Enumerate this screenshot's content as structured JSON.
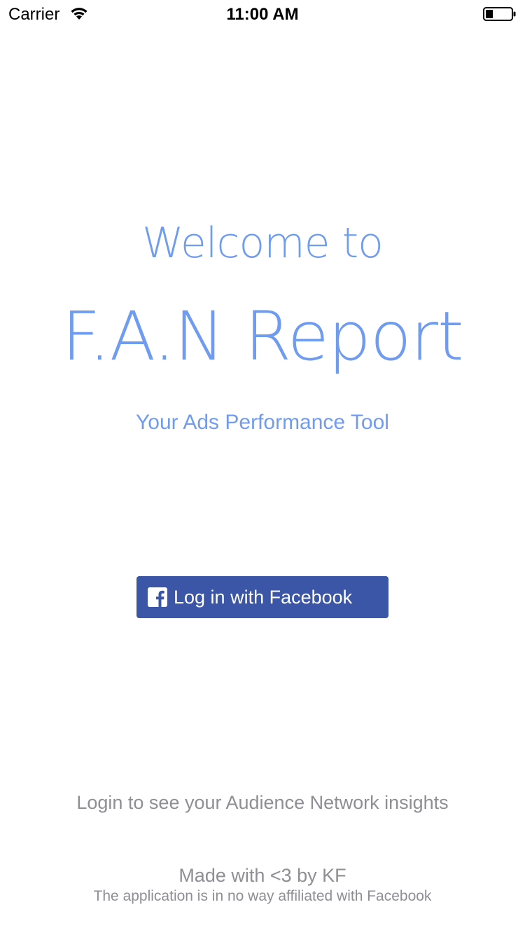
{
  "status_bar": {
    "carrier": "Carrier",
    "time": "11:00 AM",
    "wifi_icon": "wifi-icon",
    "battery_icon": "battery-icon"
  },
  "welcome": {
    "line1": "Welcome to",
    "title": "F.A.N Report",
    "tagline": "Your Ads Performance Tool"
  },
  "login": {
    "button_label": "Log in with Facebook",
    "icon": "facebook-icon",
    "button_color": "#3b56a6"
  },
  "footer": {
    "insights": "Login to see your Audience Network insights",
    "made_with": "Made with <3 by KF",
    "disclaimer": "The application is in no way affiliated with Facebook"
  },
  "colors": {
    "accent": "#6f9cf0",
    "muted_text": "#8e8e93",
    "background": "#ffffff"
  }
}
